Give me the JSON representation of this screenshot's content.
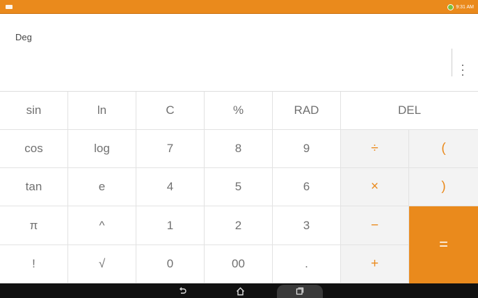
{
  "status_bar": {
    "time": "9:31 AM",
    "battery_icon": "battery-icon",
    "app_icon": "notification-icon"
  },
  "display": {
    "mode": "Deg",
    "menu_icon": "overflow-menu-icon"
  },
  "keypad": {
    "rows": [
      [
        "sin",
        "ln",
        "C",
        "%",
        "RAD",
        "DEL"
      ],
      [
        "cos",
        "log",
        "7",
        "8",
        "9",
        "÷",
        "("
      ],
      [
        "tan",
        "e",
        "4",
        "5",
        "6",
        "×",
        ")"
      ],
      [
        "π",
        "^",
        "1",
        "2",
        "3",
        "−",
        "="
      ],
      [
        "!",
        "√",
        "0",
        "00",
        ".",
        "+"
      ]
    ]
  },
  "nav_bar": {
    "back_icon": "back-icon",
    "home_icon": "home-icon",
    "recents_icon": "recents-icon"
  },
  "colors": {
    "accent": "#ea8a1c",
    "operator_bg": "#f3f3f3",
    "nav_bg": "#111111"
  }
}
